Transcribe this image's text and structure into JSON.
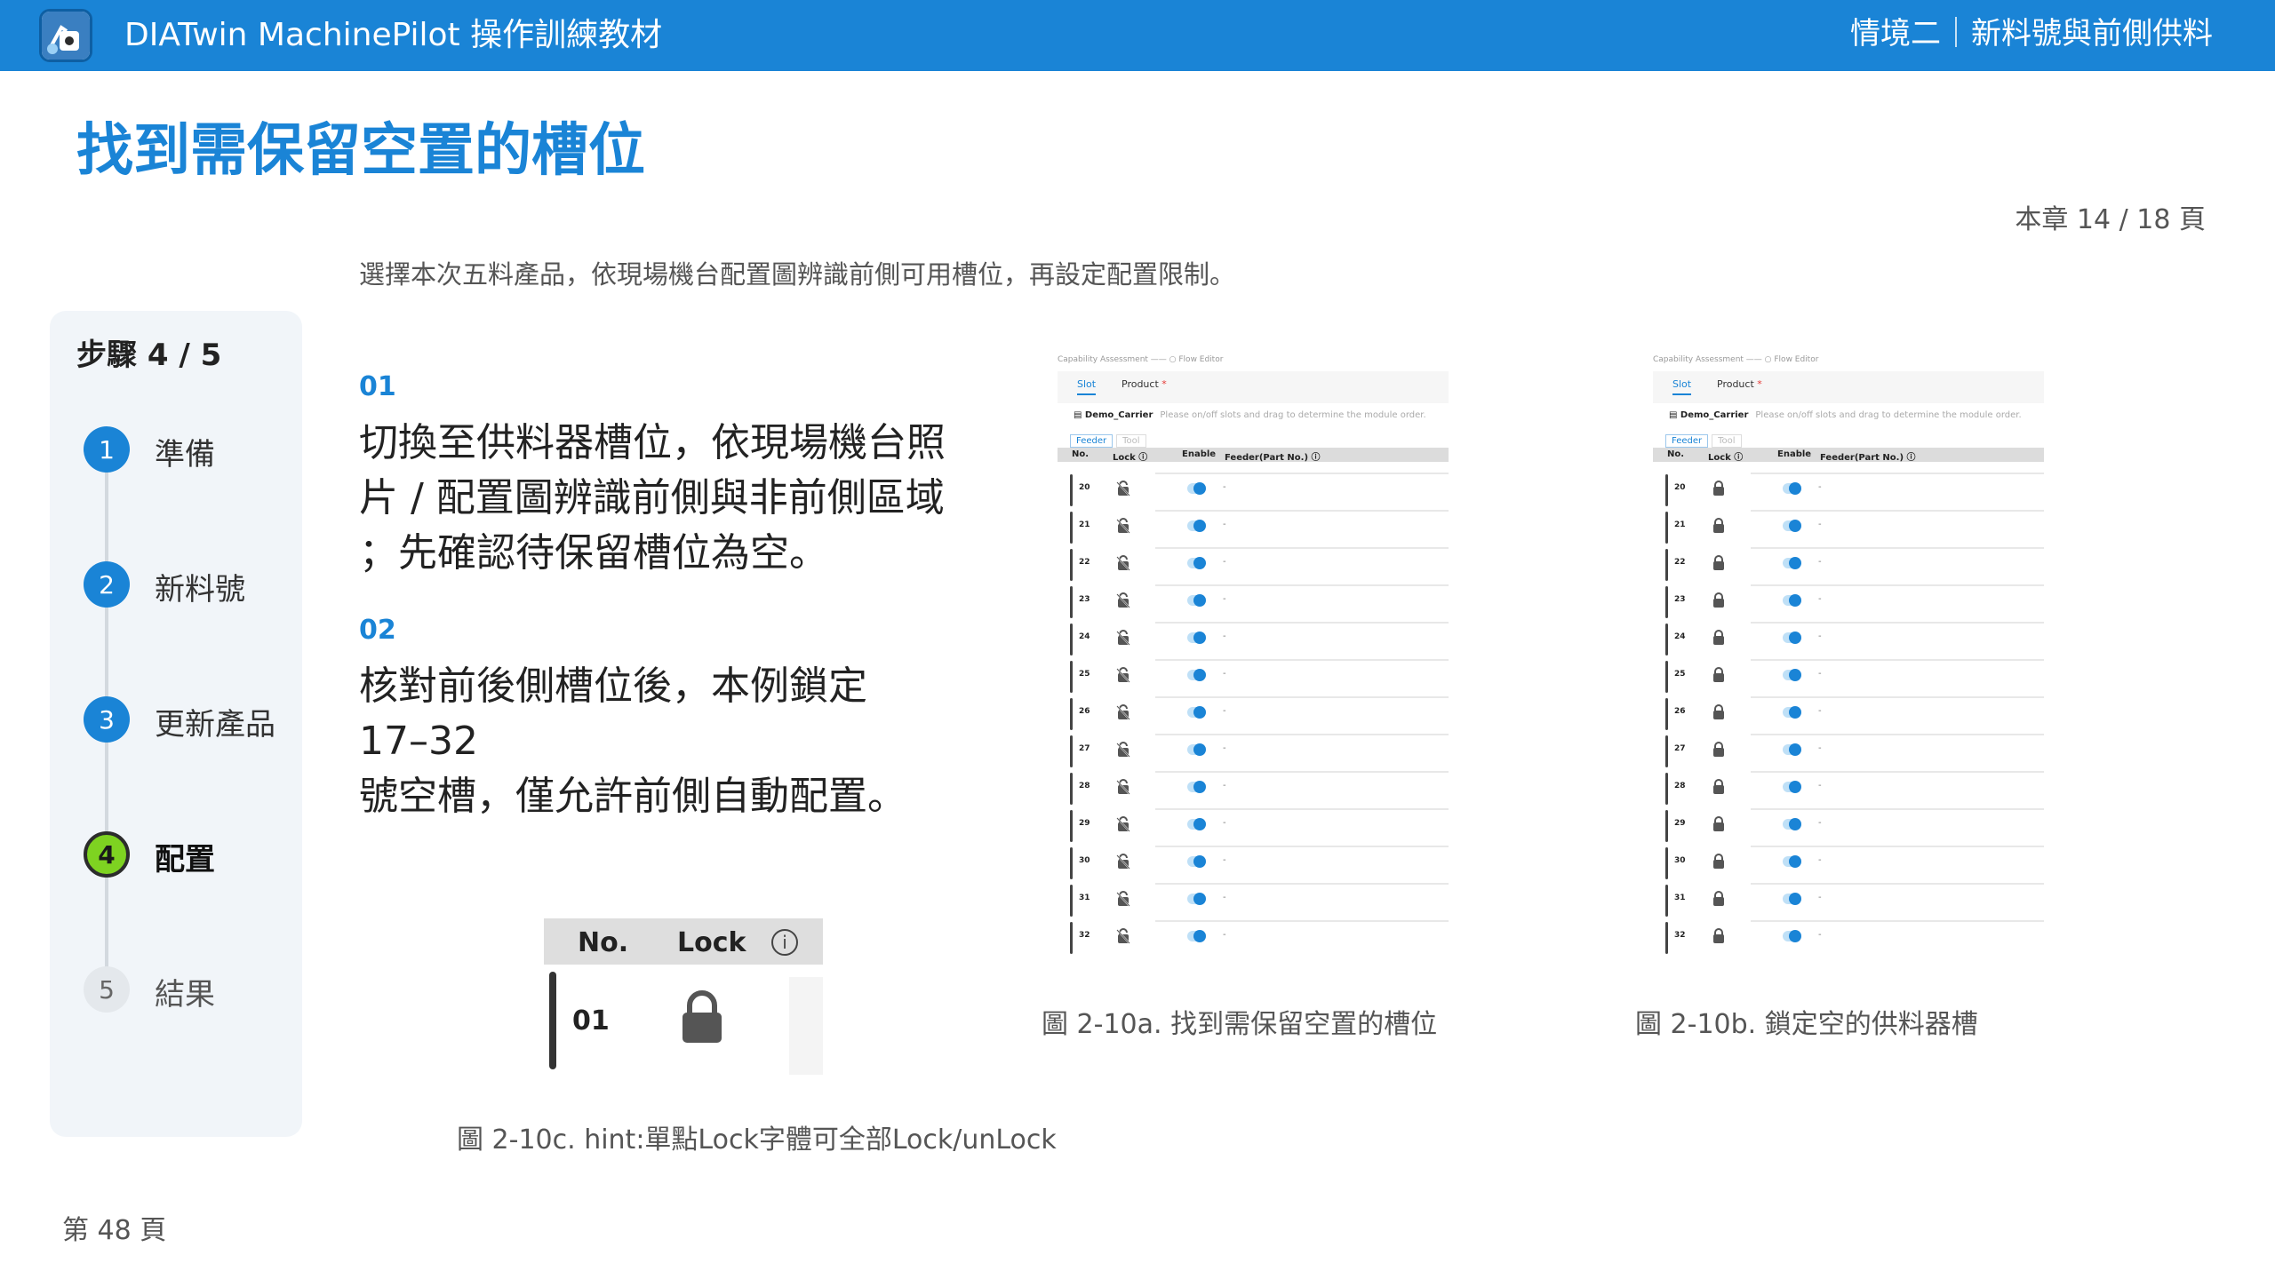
{
  "header": {
    "app_title": "DIATwin MachinePilot 操作訓練教材",
    "section": "情境二｜新料號與前側供料"
  },
  "page": {
    "title": "找到需保留空置的槽位",
    "chapter_progress": "本章 14 / 18 頁",
    "intro": "選擇本次五料產品，依現場機台配置圖辨識前側可用槽位，再設定配置限制。",
    "footer": "第 48 頁"
  },
  "steps": {
    "title": "步驟 4 / 5",
    "items": [
      {
        "num": "1",
        "label": "準備",
        "state": "done"
      },
      {
        "num": "2",
        "label": "新料號",
        "state": "done"
      },
      {
        "num": "3",
        "label": "更新產品",
        "state": "done"
      },
      {
        "num": "4",
        "label": "配置",
        "state": "active"
      },
      {
        "num": "5",
        "label": "結果",
        "state": "todo"
      }
    ]
  },
  "instructions": [
    {
      "num": "01",
      "lines": [
        "切換至供料器槽位，依現場機台照",
        "片 / 配置圖辨識前側與非前側區域",
        "；先確認待保留槽位為空。"
      ]
    },
    {
      "num": "02",
      "lines": [
        "核對前後側槽位後，本例鎖定",
        "17–32",
        "號空槽，僅允許前側自動配置。"
      ]
    }
  ],
  "screenshot_ui": {
    "breadcrumb_a": "Capability Assessment",
    "breadcrumb_b": "Flow Editor",
    "tab_slot": "Slot",
    "tab_product": "Product",
    "tab_product_mark": "*",
    "carrier_name": "Demo_Carrier",
    "carrier_hint": "Please on/off slots and drag to determine the module order.",
    "mode_feeder": "Feeder",
    "mode_tool": "Tool",
    "col_no": "No.",
    "col_lock": "Lock ⓘ",
    "col_enable": "Enable",
    "col_feeder": "Feeder(Part No.) ⓘ",
    "empty_value": "-",
    "slots": [
      "20",
      "21",
      "22",
      "23",
      "24",
      "25",
      "26",
      "27",
      "28",
      "29",
      "30",
      "31",
      "32"
    ]
  },
  "figures": {
    "a_caption": "圖 2-10a. 找到需保留空置的槽位",
    "b_caption": "圖 2-10b. 鎖定空的供料器槽",
    "c_caption": "圖 2-10c. hint:單點Lock字體可全部Lock/unLock",
    "zoom_col_no": "No.",
    "zoom_col_lock": "Lock",
    "zoom_info": "i",
    "zoom_slot": "01"
  },
  "colors": {
    "brand": "#1a84d6",
    "active_step": "#7ed321",
    "unlocked_icon": "unlocked-slot-icon",
    "locked_icon": "lock-icon"
  }
}
